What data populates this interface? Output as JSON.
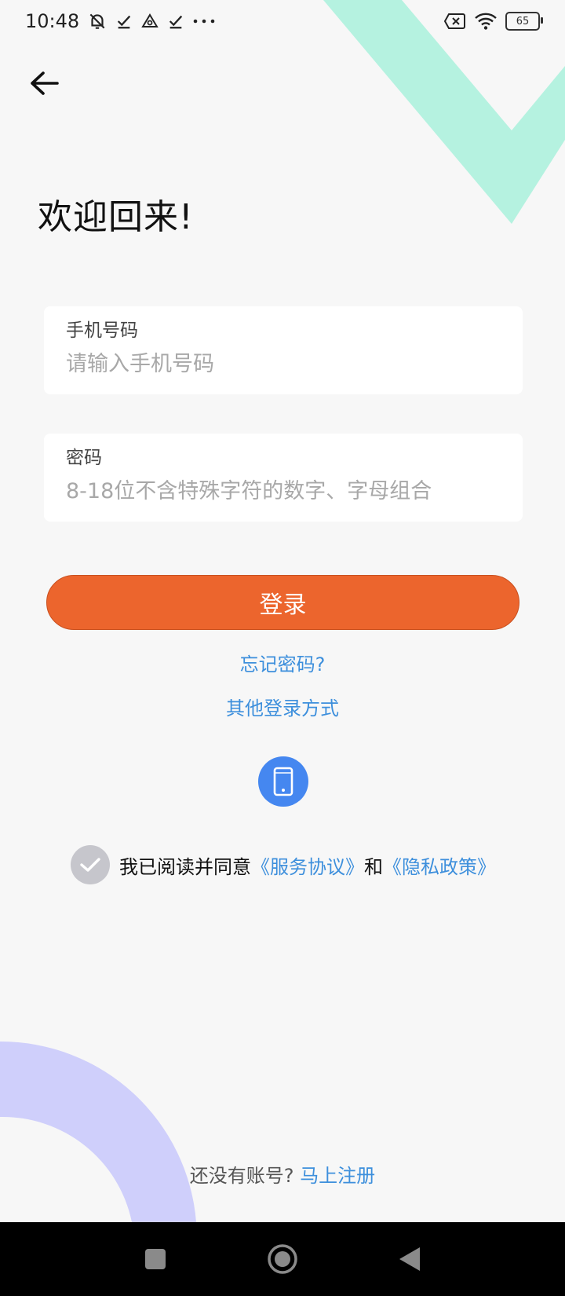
{
  "status_bar": {
    "time": "10:48",
    "battery": "65",
    "icons": [
      "notifications-off-icon",
      "check-icon",
      "triangle-icon",
      "check-icon",
      "more-dots-icon",
      "sim-x-icon",
      "wifi-icon",
      "battery-icon"
    ]
  },
  "header": {
    "back_icon": "arrow-left-icon",
    "title": "欢迎回来!"
  },
  "form": {
    "phone": {
      "label": "手机号码",
      "placeholder": "请输入手机号码",
      "value": ""
    },
    "password": {
      "label": "密码",
      "placeholder": "8-18位不含特殊字符的数字、字母组合",
      "value": ""
    },
    "login_button": "登录",
    "forgot_password": "忘记密码?",
    "other_login": "其他登录方式"
  },
  "alt_login": {
    "icon": "mobile-phone-icon"
  },
  "agreement": {
    "checked": true,
    "prefix": "我已阅读并同意",
    "service_link": "《服务协议》",
    "conjunction": "和",
    "privacy_link": "《隐私政策》"
  },
  "signup": {
    "prompt": "还没有账号?",
    "link": "马上注册"
  },
  "colors": {
    "accent": "#ec652d",
    "link": "#3d8fdc",
    "decor_green": "#b5f2e0",
    "decor_purple": "#cfcffb",
    "phone_button": "#4587f0"
  }
}
